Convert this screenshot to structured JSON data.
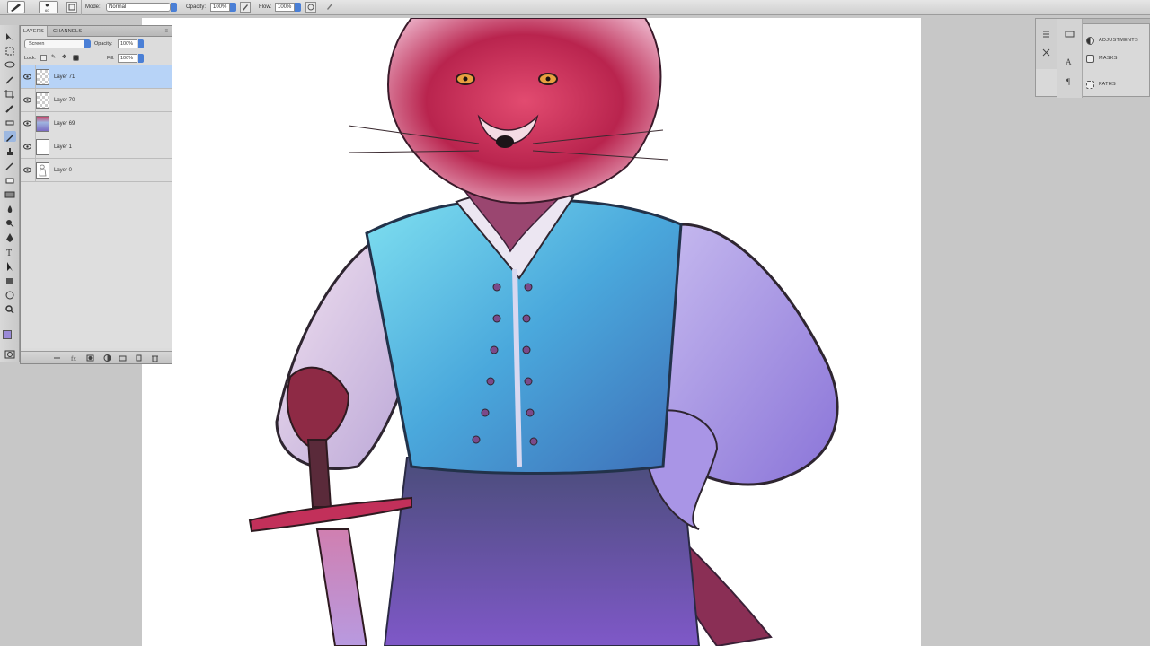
{
  "options_bar": {
    "mode_label": "Mode:",
    "mode_value": "Normal",
    "opacity_label": "Opacity:",
    "opacity_value": "100%",
    "flow_label": "Flow:",
    "flow_value": "100%",
    "brush_size": "60"
  },
  "layers_panel": {
    "tabs": [
      "LAYERS",
      "CHANNELS"
    ],
    "blend_mode": "Screen",
    "opacity_label": "Opacity:",
    "opacity_value": "100%",
    "lock_label": "Lock:",
    "fill_label": "Fill:",
    "fill_value": "100%",
    "layers": [
      {
        "name": "Layer 71",
        "visible": true,
        "selected": true,
        "thumb": "transparent"
      },
      {
        "name": "Layer 70",
        "visible": true,
        "selected": false,
        "thumb": "transparent"
      },
      {
        "name": "Layer 69",
        "visible": true,
        "selected": false,
        "thumb": "color"
      },
      {
        "name": "Layer 1",
        "visible": true,
        "selected": false,
        "thumb": "white"
      },
      {
        "name": "Layer 0",
        "visible": true,
        "selected": false,
        "thumb": "sketch"
      }
    ]
  },
  "dock": {
    "items": [
      "ADJUSTMENTS",
      "MASKS",
      "PATHS"
    ]
  },
  "colors": {
    "foreground": "#9a8ad8",
    "background": "#ffffff",
    "selection": "#b7d3f7",
    "accent": "#4a7fd6"
  }
}
